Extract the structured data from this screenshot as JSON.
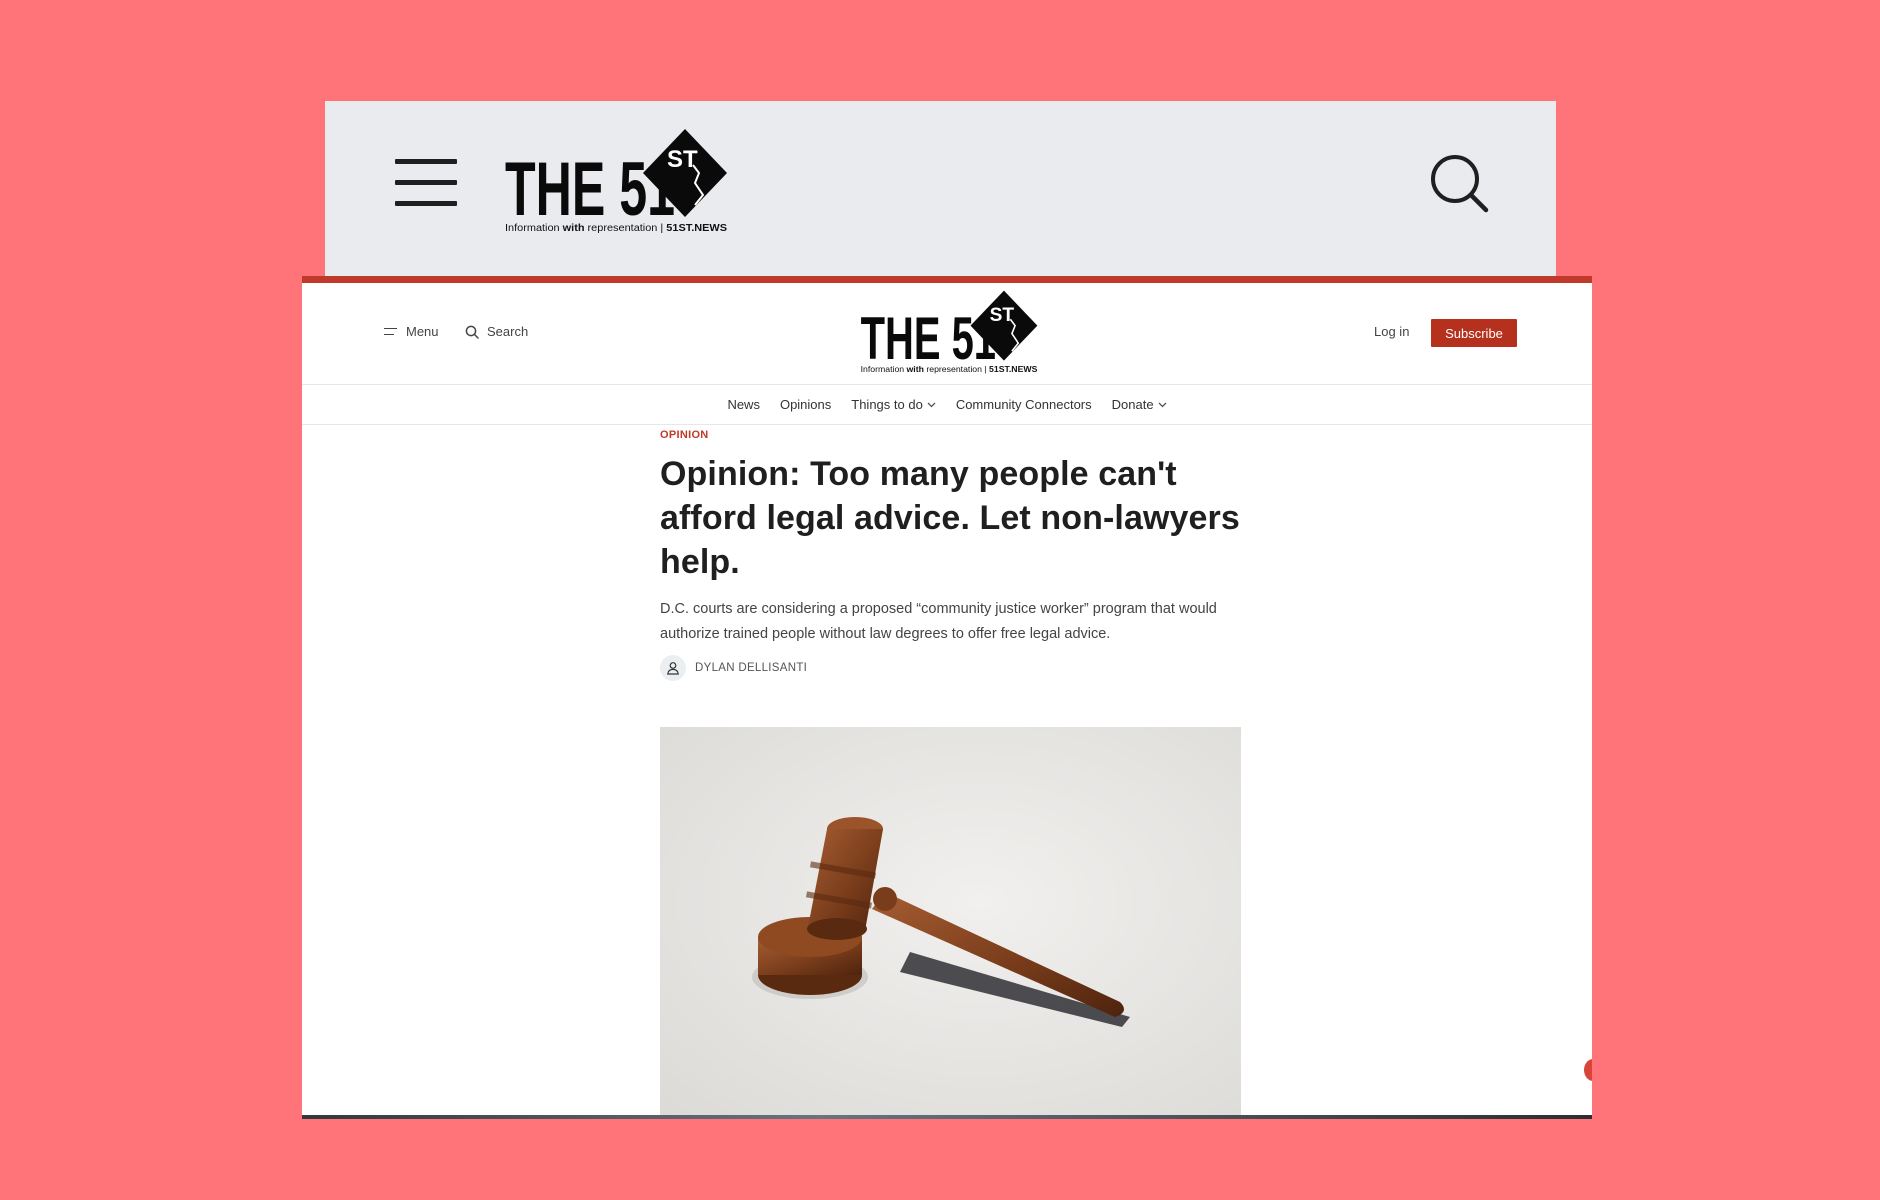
{
  "brand": {
    "wordmark": "THE 51",
    "superscript": "ST",
    "tagline_pre": "Information ",
    "tagline_bold": "with",
    "tagline_post": " representation | ",
    "tagline_site": "51ST.NEWS"
  },
  "header": {
    "menu_label": "Menu",
    "search_label": "Search",
    "login_label": "Log in",
    "subscribe_label": "Subscribe"
  },
  "nav": {
    "items": [
      "News",
      "Opinions",
      "Things to do",
      "Community Connectors",
      "Donate"
    ]
  },
  "article": {
    "kicker": "OPINION",
    "headline": "Opinion: Too many people can't afford legal advice. Let non-lawyers help.",
    "dek": "D.C. courts are considering a proposed “community justice worker” program that would authorize trained people without law degrees to offer free legal advice.",
    "author": "DYLAN DELLISANTI"
  },
  "colors": {
    "background": "#ff7479",
    "accent": "#b5301d",
    "kicker": "#c0392b"
  }
}
